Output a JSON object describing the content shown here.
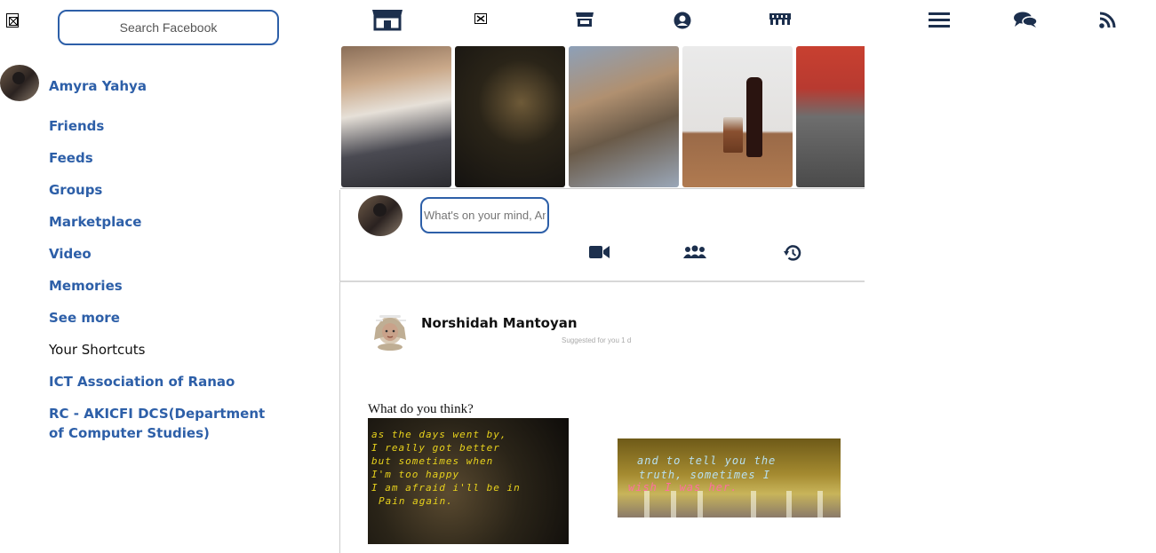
{
  "header": {
    "search_placeholder": "Search Facebook",
    "nav_icons": [
      "store-icon",
      "broken-image-icon",
      "shop-icon",
      "user-circle-icon",
      "ticket-icon",
      "menu-icon",
      "chat-icon",
      "rss-icon"
    ]
  },
  "sidebar": {
    "profile_name": "Amyra Yahya",
    "links": [
      "Friends",
      "Feeds",
      "Groups",
      "Marketplace",
      "Video",
      "Memories",
      "See more"
    ],
    "shortcuts_label": "Your Shortcuts",
    "shortcuts": [
      "ICT Association of Ranao",
      "RC - AKICFI DCS(Department of Computer Studies)"
    ]
  },
  "composer": {
    "placeholder": "What's on your mind, Amyra?",
    "action_icons": [
      "video-camera-icon",
      "people-group-icon",
      "history-icon"
    ]
  },
  "post": {
    "author": "Norshidah Mantoyan",
    "meta": "Suggested for you 1 d",
    "text": "What do you think?",
    "image1_lines": [
      "as the days went by,",
      "I really got better",
      "but sometimes when",
      "I'm too happy",
      "I am afraid i'll be in",
      "Pain again."
    ],
    "image2_lines": [
      "and to tell you the",
      "truth, sometimes I",
      "wish I was her."
    ]
  },
  "colors": {
    "link": "#2d5fa8",
    "icon": "#1c2f4d",
    "border": "#2d5fa8"
  }
}
